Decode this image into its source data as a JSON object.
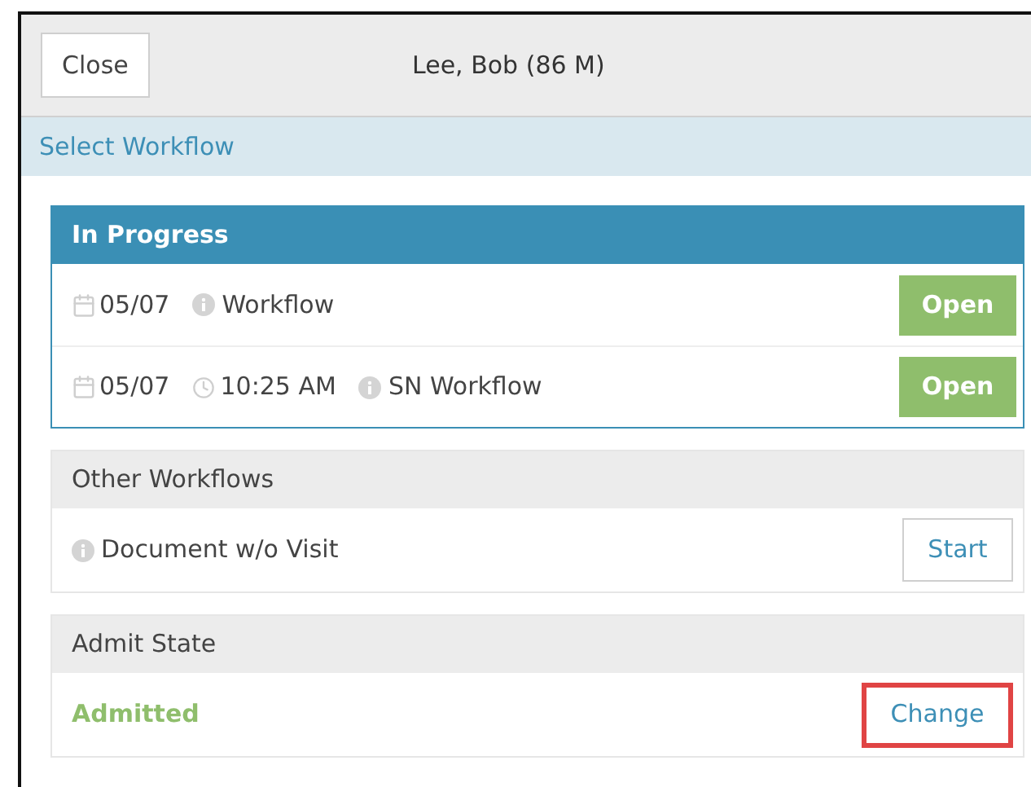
{
  "header": {
    "close_button": "Close",
    "patient": "Lee, Bob (86 M)"
  },
  "subheader": "Select Workflow",
  "in_progress": {
    "title": "In Progress",
    "rows": [
      {
        "date": "05/07",
        "name": "Workflow",
        "action": "Open"
      },
      {
        "date": "05/07",
        "time": "10:25 AM",
        "name": "SN Workflow",
        "action": "Open"
      }
    ]
  },
  "other_workflows": {
    "title": "Other Workflows",
    "rows": [
      {
        "name": "Document w/o Visit",
        "action": "Start"
      }
    ]
  },
  "admit_state": {
    "title": "Admit State",
    "status": "Admitted",
    "action": "Change",
    "highlighted": true
  }
}
